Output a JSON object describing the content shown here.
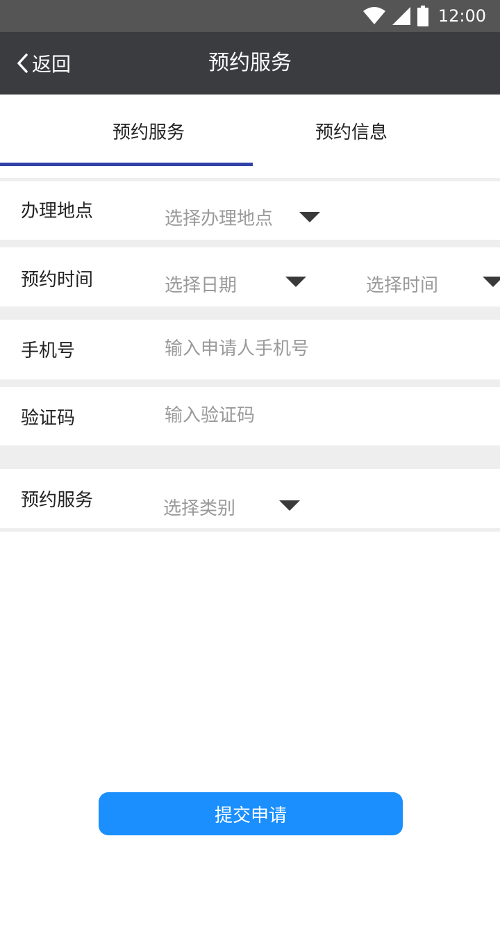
{
  "status_bar": {
    "time": "12:00"
  },
  "nav": {
    "back_label": "返回",
    "title": "预约服务"
  },
  "tabs": [
    {
      "label": "预约服务",
      "active": true
    },
    {
      "label": "预约信息",
      "active": false
    }
  ],
  "form": {
    "location": {
      "label": "办理地点",
      "placeholder": "选择办理地点"
    },
    "time": {
      "label": "预约时间",
      "date_placeholder": "选择日期",
      "time_placeholder": "选择时间"
    },
    "phone": {
      "label": "手机号",
      "placeholder": "输入申请人手机号"
    },
    "code": {
      "label": "验证码",
      "placeholder": "输入验证码"
    },
    "service": {
      "label": "预约服务",
      "placeholder": "选择类别"
    }
  },
  "submit_label": "提交申请",
  "colors": {
    "accent": "#1a8ffd",
    "tab_indicator": "#3142a8",
    "nav_bg": "#3b3c40",
    "status_bg": "#555555"
  },
  "icons": [
    "wifi-icon",
    "cell-signal-icon",
    "battery-icon",
    "back-chevron-icon",
    "caret-down-icon"
  ]
}
